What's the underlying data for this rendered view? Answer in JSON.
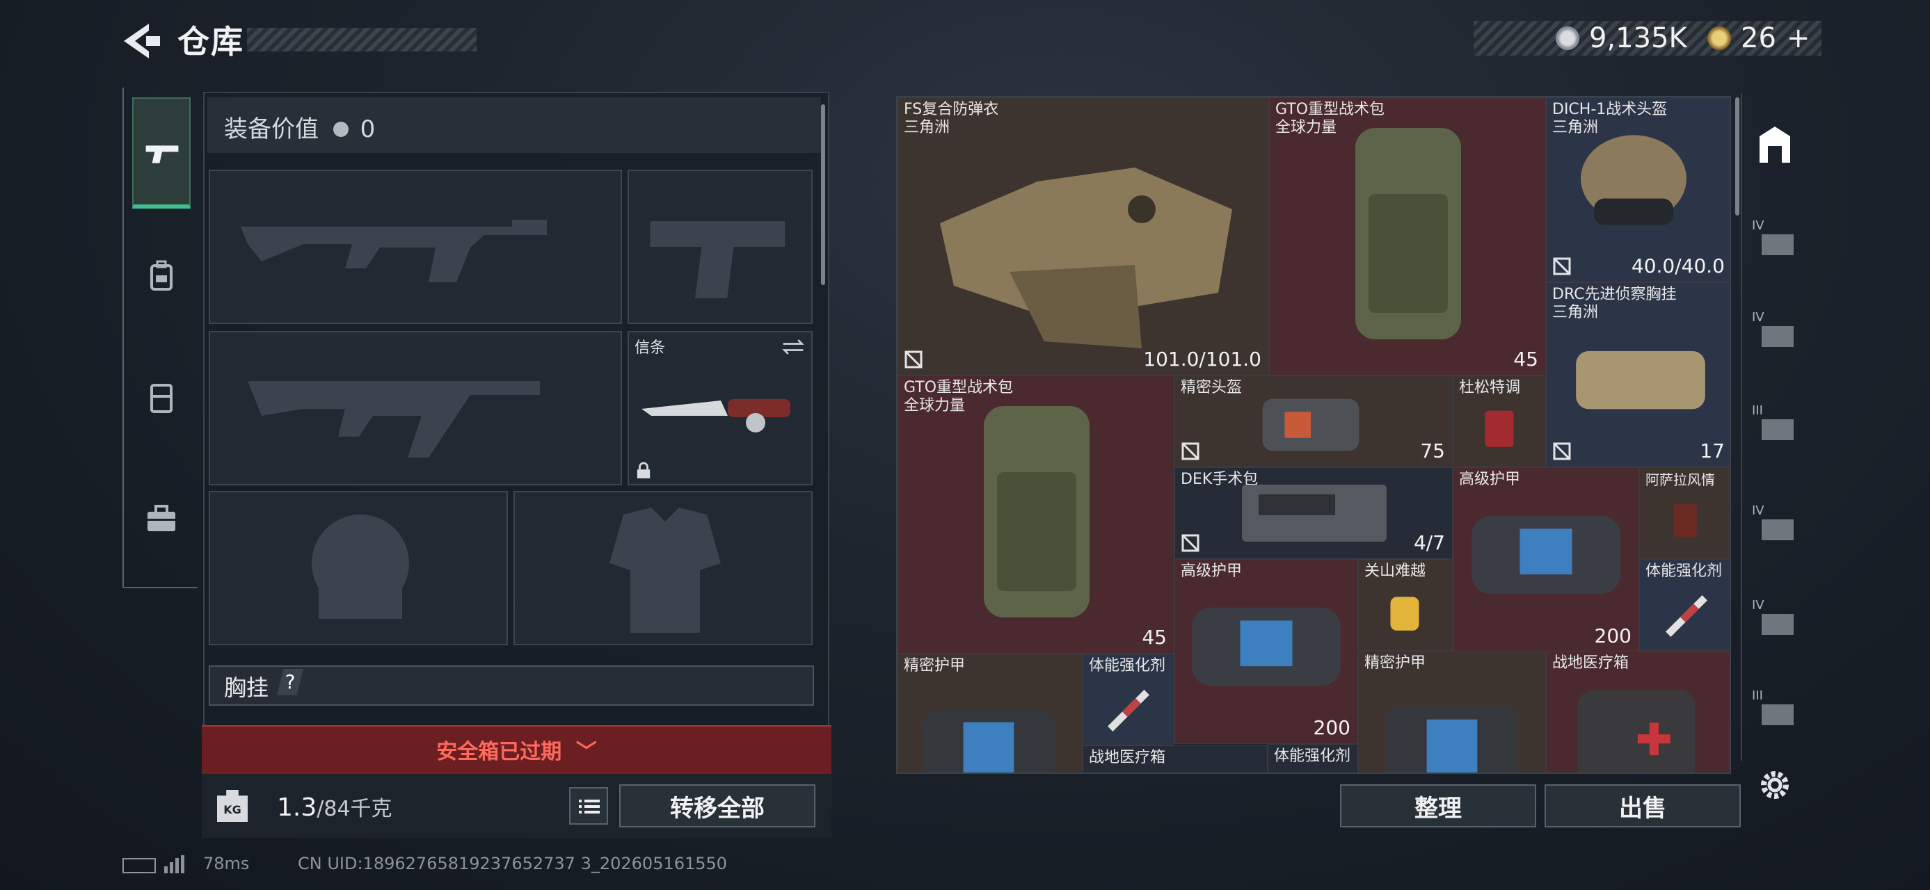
{
  "header": {
    "title": "仓库"
  },
  "currency": {
    "coins": "9,135K",
    "tickets": "26",
    "plus": "+"
  },
  "equipment": {
    "value_label": "装备价值",
    "value": "0",
    "melee_label": "信条",
    "chest_rig_label": "胸挂",
    "help": "?"
  },
  "safe_box": {
    "label": "安全箱已过期"
  },
  "weight": {
    "current": "1.3",
    "max": "/84千克",
    "unit_icon": "KG"
  },
  "buttons": {
    "transfer_all": "转移全部",
    "sort": "整理",
    "sell": "出售"
  },
  "stash": {
    "items": [
      {
        "name": "FS复合防弹衣",
        "sub": "三角洲",
        "stat": "101.0/101.0"
      },
      {
        "name": "GTO重型战术包",
        "sub": "全球力量",
        "stat": "45"
      },
      {
        "name": "DICH-1战术头盔",
        "sub": "三角洲",
        "stat": "40.0/40.0"
      },
      {
        "name": "DRC先进侦察胸挂",
        "sub": "三角洲",
        "stat": "17"
      },
      {
        "name": "GTO重型战术包",
        "sub": "全球力量",
        "stat": "45"
      },
      {
        "name": "精密头盔",
        "sub": "",
        "stat": "75"
      },
      {
        "name": "杜松特调",
        "sub": "",
        "stat": ""
      },
      {
        "name": "DEK手术包",
        "sub": "",
        "stat": "4/7"
      },
      {
        "name": "高级护甲",
        "sub": "",
        "stat": "200"
      },
      {
        "name": "阿萨拉风情",
        "sub": "",
        "stat": ""
      },
      {
        "name": "高级护甲",
        "sub": "",
        "stat": "200"
      },
      {
        "name": "关山难越",
        "sub": "",
        "stat": ""
      },
      {
        "name": "体能强化剂",
        "sub": "",
        "stat": ""
      },
      {
        "name": "精密护甲",
        "sub": "",
        "stat": ""
      },
      {
        "name": "体能强化剂",
        "sub": "",
        "stat": ""
      },
      {
        "name": "精密护甲",
        "sub": "",
        "stat": ""
      },
      {
        "name": "战地医疗箱",
        "sub": "",
        "stat": ""
      },
      {
        "name": "战地医疗箱",
        "sub": "",
        "stat": ""
      },
      {
        "name": "体能强化剂",
        "sub": "",
        "stat": ""
      }
    ]
  },
  "side_tabs": [
    "IV",
    "IV",
    "III",
    "IV",
    "IV",
    "III"
  ],
  "status": {
    "ping": "78ms",
    "uid": "CN UID:18962765819237652737 3_202605161550"
  },
  "colors": {
    "accent": "#3fbf8e",
    "danger": "#ff6a5b",
    "red_cell": "#4b2a2f"
  }
}
